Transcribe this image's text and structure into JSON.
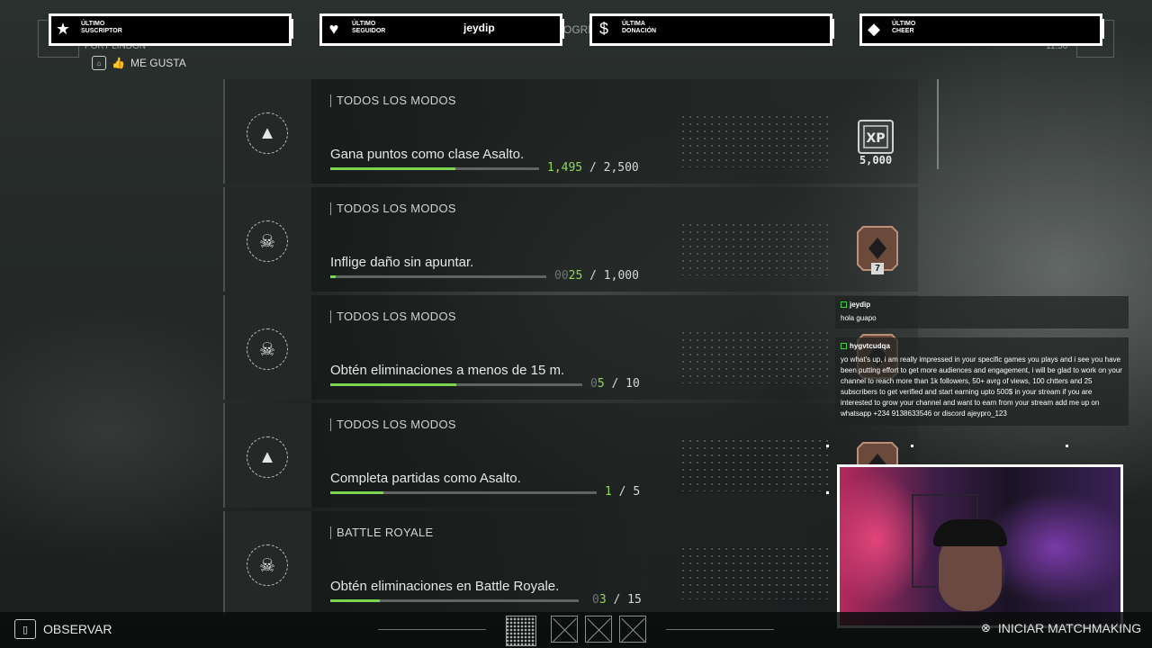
{
  "alerts": [
    {
      "icon": "star-icon",
      "label_line1": "ÚLTIMO",
      "label_line2": "SUSCRIPTOR",
      "name": ""
    },
    {
      "icon": "heart-icon",
      "label_line1": "ÚLTIMO",
      "label_line2": "SEGUIDOR",
      "name": "jeydip"
    },
    {
      "icon": "dollar-icon",
      "label_line1": "ÚLTIMA",
      "label_line2": "DONACIÓN",
      "name": ""
    },
    {
      "icon": "diamond-icon",
      "label_line1": "ÚLTIMO",
      "label_line2": "CHEER",
      "name": ""
    }
  ],
  "header": {
    "location_fragment": "PORT LINDON",
    "tab_fragment": "OGRES",
    "time_fragment": "11:50",
    "like_label": "ME GUSTA"
  },
  "challenges": [
    {
      "mode": "TODOS LOS MODOS",
      "description": "Gana puntos como clase Asalto.",
      "current": "1,495",
      "total": "2,500",
      "progress": 0.598,
      "icon": "class-assault-icon",
      "reward": "xp"
    },
    {
      "mode": "TODOS LOS MODOS",
      "description": "Inflige daño sin apuntar.",
      "current_dim": "00",
      "current": "25",
      "total": "1,000",
      "progress": 0.025,
      "icon": "skull-crossbones-icon",
      "reward": "card",
      "reward_badge": "7"
    },
    {
      "mode": "TODOS LOS MODOS",
      "description": "Obtén eliminaciones a menos de 15 m.",
      "current_dim": "0",
      "current": "5",
      "total": "10",
      "progress": 0.5,
      "icon": "skull-crossbones-icon",
      "reward": "card"
    },
    {
      "mode": "TODOS LOS MODOS",
      "description": "Completa partidas como Asalto.",
      "current": "1",
      "total": "5",
      "progress": 0.2,
      "icon": "class-assault-icon",
      "reward": "card"
    },
    {
      "mode": "BATTLE ROYALE",
      "description": "Obtén eliminaciones en Battle Royale.",
      "current_dim": "0",
      "current": "3",
      "total": "15",
      "progress": 0.2,
      "icon": "skull-crossbones-icon",
      "reward": "card"
    }
  ],
  "xp_reward": {
    "label": "XP",
    "amount": "5,000"
  },
  "chat": [
    {
      "user": "jeydip",
      "message": "hola guapo"
    },
    {
      "user": "hygvtcudqa",
      "message": "yo what's up, i am really impressed in your specific games you plays and i see you have been putting effort to get more audiences and engagement, i will be glad to work on your channel to reach more than 1k followers, 50+ avrg of views, 100 chtters and 25 subscribers to get verified and start earning upto 500$ in your stream if you are interested to grow your channel and want to earn from your stream add me up on whatsapp +234 9138633546 or discord ajeypro_123"
    }
  ],
  "bottom": {
    "observe_label": "OBSERVAR",
    "matchmaking_label": "INICIAR MATCHMAKING"
  },
  "colors": {
    "progress_fill": "#7cd34e",
    "chat_badge": "#3ecf4a"
  }
}
